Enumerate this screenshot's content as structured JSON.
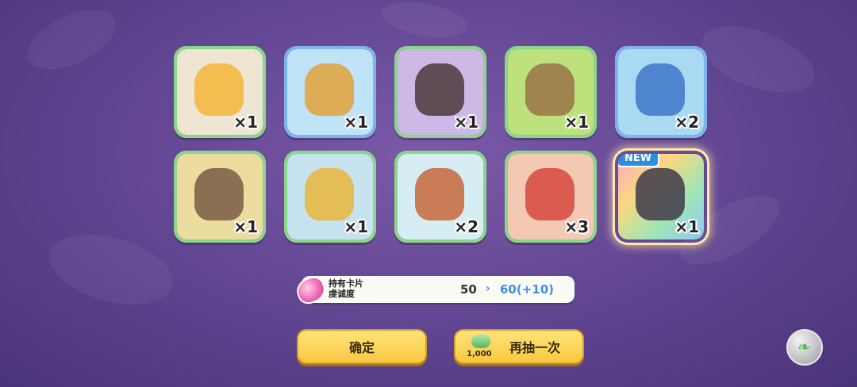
{
  "items": [
    {
      "name": "item-box-card",
      "qty": "×1",
      "frame": "green",
      "bg": "#eee6d2",
      "accent": "#f3b53a"
    },
    {
      "name": "item-harness",
      "qty": "×1",
      "frame": "blue",
      "bg": "#bfe4f7",
      "accent": "#e0a23a"
    },
    {
      "name": "item-characters-card",
      "qty": "×1",
      "frame": "green",
      "bg": "#cdb8e6",
      "accent": "#4a3a3a"
    },
    {
      "name": "item-backpack",
      "qty": "×1",
      "frame": "green",
      "bg": "#bde27d",
      "accent": "#9a7345"
    },
    {
      "name": "item-goblet",
      "qty": "×2",
      "frame": "blue",
      "bg": "#a9daf2",
      "accent": "#3f74c9"
    },
    {
      "name": "item-knight-card",
      "qty": "×1",
      "frame": "green",
      "bg": "#ecdca0",
      "accent": "#7a5c44"
    },
    {
      "name": "item-gold-card",
      "qty": "×1",
      "frame": "green",
      "bg": "#c8e3f0",
      "accent": "#e9b63b"
    },
    {
      "name": "item-dash-card",
      "qty": "×2",
      "frame": "green",
      "bg": "#d6eef3",
      "accent": "#c7673a"
    },
    {
      "name": "item-reader-card",
      "qty": "×3",
      "frame": "green",
      "bg": "#f3c9b3",
      "accent": "#d6483f"
    },
    {
      "name": "item-new-card",
      "qty": "×1",
      "frame": "rainbow",
      "bg": "#3e3a4a",
      "accent": "#7ec98a",
      "badge": "NEW"
    }
  ],
  "affinity": {
    "label": "持有卡片\n虔诚度",
    "from": "50",
    "arrow": "›",
    "to": "60(+10)"
  },
  "buttons": {
    "confirm": "确定",
    "redraw": "再抽一次",
    "redraw_cost": "1,000"
  }
}
